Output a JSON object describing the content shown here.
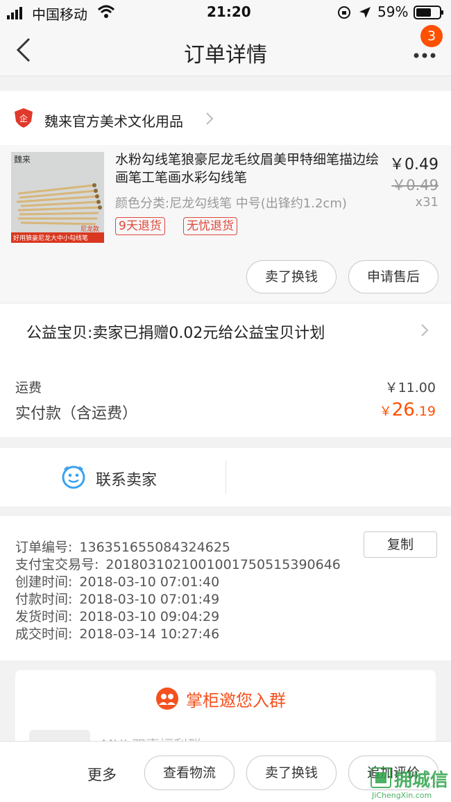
{
  "status": {
    "carrier": "中国移动",
    "time": "21:20",
    "battery": "59%"
  },
  "nav": {
    "title": "订单详情",
    "badge": "3"
  },
  "shop": {
    "name": "魏来官方美术文化用品"
  },
  "item": {
    "title": "水粉勾线笔狼豪尼龙毛纹眉美甲特细笔描边绘画笔工笔画水彩勾线笔",
    "price": "￥0.49",
    "orig_price": "￥0.49",
    "sku": "颜色分类:尼龙勾线笔 中号(出锋约1.2cm)",
    "qty": "x31",
    "tags": [
      "9天退货",
      "无忧退货"
    ],
    "thumb_text": {
      "brand": "魏来",
      "caption": "好用狼豪尼龙大中小勾线笔",
      "corner": "尼龙款"
    }
  },
  "item_actions": {
    "sell": "卖了换钱",
    "aftersale": "申请售后"
  },
  "charity": "公益宝贝:卖家已捐赠0.02元给公益宝贝计划",
  "fees": {
    "shipping_label": "运费",
    "shipping_value": "￥11.00",
    "paid_label": "实付款（含运费）",
    "paid_currency": "￥",
    "paid_main": "26",
    "paid_decimal": ".19"
  },
  "contact": {
    "label": "联系卖家"
  },
  "order": {
    "copy": "复制",
    "rows": [
      {
        "label": "订单编号:",
        "value": "136351655084324625"
      },
      {
        "label": "支付宝交易号:",
        "value": "2018031021001001750515390646"
      },
      {
        "label": "创建时间:",
        "value": "2018-03-10 07:01:40"
      },
      {
        "label": "付款时间:",
        "value": "2018-03-10 07:01:49"
      },
      {
        "label": "发货时间:",
        "value": "2018-03-10 09:04:29"
      },
      {
        "label": "成交时间:",
        "value": "2018-03-14 10:27:46"
      }
    ]
  },
  "group": {
    "title": "掌柜邀您入群",
    "partial_text": "MUI 双喜福利群"
  },
  "bottom": {
    "more": "更多",
    "logistics": "查看物流",
    "sell": "卖了换钱",
    "review": "追加评价"
  },
  "watermark": {
    "main": "拥城信",
    "site": "JiChengXin.com"
  },
  "colors": {
    "accent": "#ff5000",
    "tag": "#e0473a",
    "icon_blue": "#3aa2f0"
  }
}
